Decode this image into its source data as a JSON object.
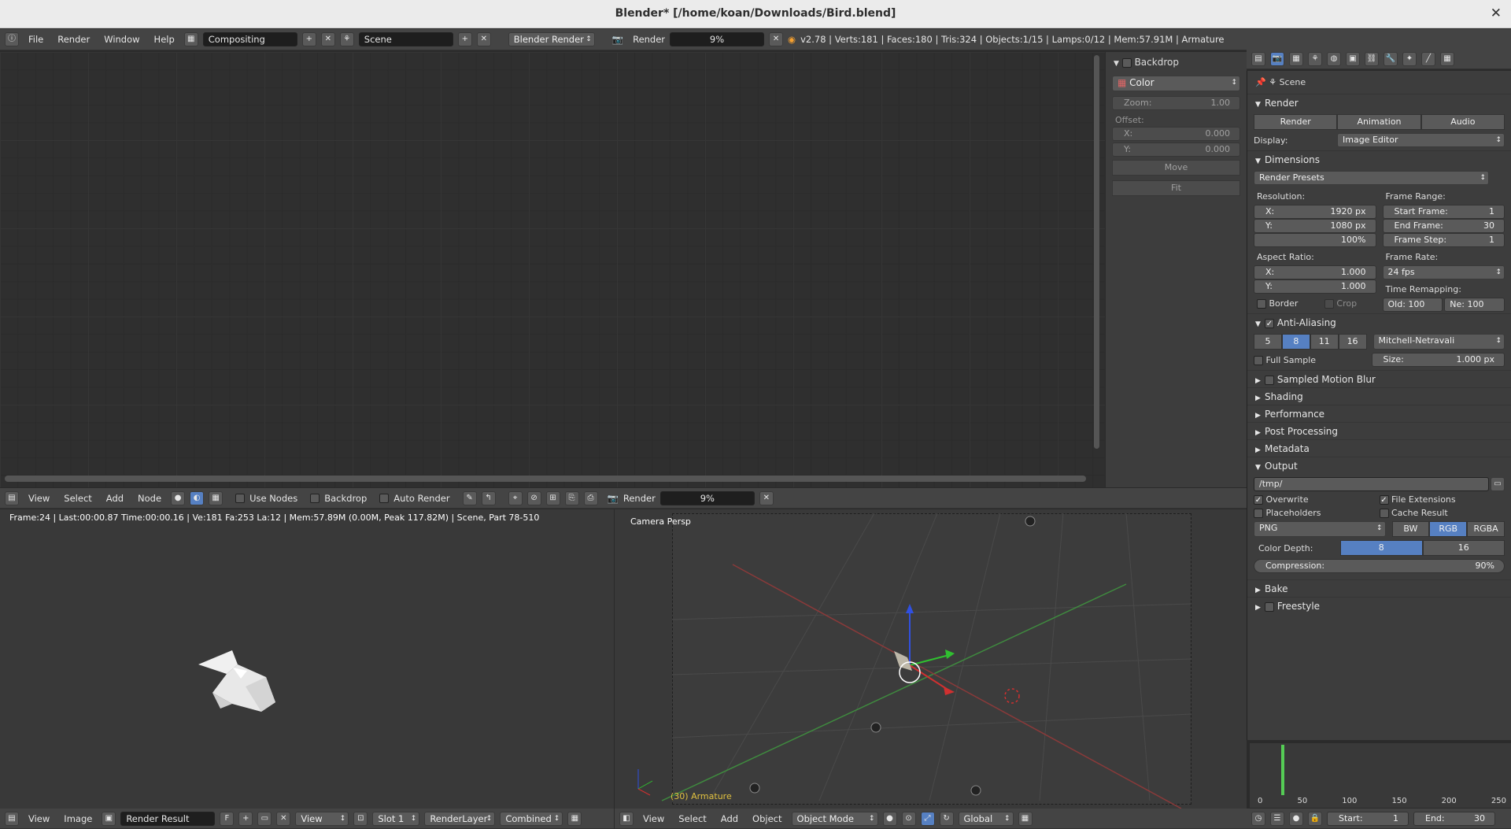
{
  "window": {
    "title": "Blender* [/home/koan/Downloads/Bird.blend]",
    "close": "✕"
  },
  "topbar": {
    "menus": [
      "File",
      "Render",
      "Window",
      "Help"
    ],
    "screen": "Compositing",
    "scene": "Scene",
    "engine": "Blender Render",
    "render_label": "Render",
    "progress": "9%",
    "stats": "v2.78 | Verts:181 | Faces:180 | Tris:324 | Objects:1/15 | Lamps:0/12 | Mem:57.91M | Armature"
  },
  "node_editor": {
    "menus": [
      "View",
      "Select",
      "Add",
      "Node"
    ],
    "use_nodes": "Use Nodes",
    "backdrop": "Backdrop",
    "auto_render": "Auto Render",
    "render_label": "Render",
    "progress": "9%"
  },
  "backdrop_panel": {
    "title": "Backdrop",
    "channel": "Color",
    "zoom_label": "Zoom:",
    "zoom": "1.00",
    "offset_label": "Offset:",
    "x_label": "X:",
    "x": "0.000",
    "y_label": "Y:",
    "y": "0.000",
    "move": "Move",
    "fit": "Fit"
  },
  "image_editor": {
    "info": "Frame:24 | Last:00:00.87 Time:00:00.16 | Ve:181 Fa:253 La:12 | Mem:57.89M (0.00M, Peak 117.82M) | Scene, Part 78-510",
    "menus": [
      "View",
      "Image"
    ],
    "image": "Render Result",
    "fake": "F",
    "view": "View",
    "slot": "Slot 1",
    "layer": "RenderLayer",
    "pass": "Combined"
  },
  "viewport": {
    "label": "Camera Persp",
    "object": "(30) Armature",
    "menus": [
      "View",
      "Select",
      "Add",
      "Object"
    ],
    "mode": "Object Mode",
    "orientation": "Global"
  },
  "properties": {
    "context": "Scene",
    "render": {
      "title": "Render",
      "buttons": [
        "Render",
        "Animation",
        "Audio"
      ],
      "display_label": "Display:",
      "display": "Image Editor"
    },
    "dimensions": {
      "title": "Dimensions",
      "presets": "Render Presets",
      "resolution_label": "Resolution:",
      "res_x_label": "X:",
      "res_x": "1920 px",
      "res_y_label": "Y:",
      "res_y": "1080 px",
      "res_pct": "100%",
      "frame_range_label": "Frame Range:",
      "start_label": "Start Frame:",
      "start": "1",
      "end_label": "End Frame:",
      "end": "30",
      "step_label": "Frame Step:",
      "step": "1",
      "aspect_label": "Aspect Ratio:",
      "asp_x_label": "X:",
      "asp_x": "1.000",
      "asp_y_label": "Y:",
      "asp_y": "1.000",
      "frame_rate_label": "Frame Rate:",
      "fps": "24 fps",
      "remap_label": "Time Remapping:",
      "old": "Old: 100",
      "new": "Ne: 100",
      "border": "Border",
      "crop": "Crop"
    },
    "aa": {
      "title": "Anti-Aliasing",
      "samples": [
        "5",
        "8",
        "11",
        "16"
      ],
      "filter": "Mitchell-Netravali",
      "full_sample": "Full Sample",
      "size_label": "Size:",
      "size": "1.000 px"
    },
    "panels": [
      "Sampled Motion Blur",
      "Shading",
      "Performance",
      "Post Processing",
      "Metadata"
    ],
    "output": {
      "title": "Output",
      "path": "/tmp/",
      "overwrite": "Overwrite",
      "file_ext": "File Extensions",
      "placeholders": "Placeholders",
      "cache": "Cache Result",
      "format": "PNG",
      "modes": [
        "BW",
        "RGB",
        "RGBA"
      ],
      "depth_label": "Color Depth:",
      "depths": [
        "8",
        "16"
      ],
      "compression_label": "Compression:",
      "compression": "90%"
    },
    "bake": "Bake",
    "freestyle": "Freestyle"
  },
  "timeline": {
    "ticks": [
      "0",
      "50",
      "100",
      "150",
      "200",
      "250"
    ],
    "start": "Start:",
    "start_val": "1",
    "end": "End:",
    "end_val": "30"
  },
  "colors": {
    "accent": "#5680c2"
  }
}
